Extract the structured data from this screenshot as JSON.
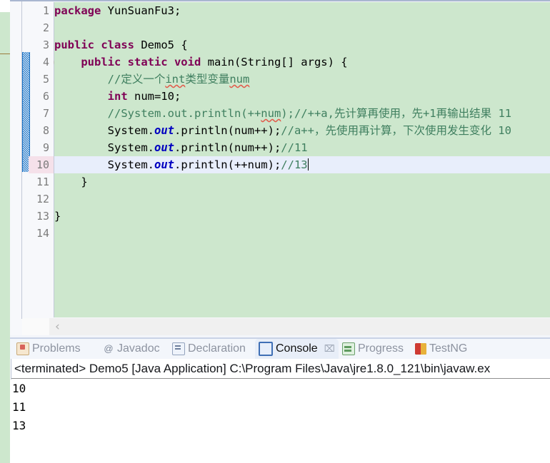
{
  "editor": {
    "gutter_lines": [
      "1",
      "2",
      "3",
      "4",
      "5",
      "6",
      "7",
      "8",
      "9",
      "10",
      "11",
      "12",
      "13",
      "14"
    ],
    "current_line": "10",
    "fold_marker_line": "4",
    "lines": [
      {
        "n": "1",
        "segments": [
          {
            "t": "package ",
            "c": "kw"
          },
          {
            "t": "YunSuanFu3;",
            "c": "plain"
          }
        ]
      },
      {
        "n": "2",
        "segments": []
      },
      {
        "n": "3",
        "segments": [
          {
            "t": "public class ",
            "c": "kw"
          },
          {
            "t": "Demo5 {",
            "c": "plain"
          }
        ]
      },
      {
        "n": "4",
        "segments": [
          {
            "t": "    ",
            "c": "plain"
          },
          {
            "t": "public static void ",
            "c": "kw"
          },
          {
            "t": "main(String[] args) {",
            "c": "plain"
          }
        ]
      },
      {
        "n": "5",
        "segments": [
          {
            "t": "        ",
            "c": "plain"
          },
          {
            "t": "//定义一个int类型变量num",
            "c": "cmt"
          }
        ]
      },
      {
        "n": "6",
        "segments": [
          {
            "t": "        ",
            "c": "plain"
          },
          {
            "t": "int ",
            "c": "kw"
          },
          {
            "t": "num=",
            "c": "plain"
          },
          {
            "t": "10",
            "c": "plain"
          },
          {
            "t": ";",
            "c": "plain"
          }
        ]
      },
      {
        "n": "7",
        "segments": [
          {
            "t": "        ",
            "c": "plain"
          },
          {
            "t": "//System.out.println(++num);//++a,先计算再使用，先+1再输出结果 11",
            "c": "cmt"
          }
        ]
      },
      {
        "n": "8",
        "segments": [
          {
            "t": "        ",
            "c": "plain"
          },
          {
            "t": "System.",
            "c": "plain"
          },
          {
            "t": "out",
            "c": "fld"
          },
          {
            "t": ".println(num++);",
            "c": "plain"
          },
          {
            "t": "//a++，先使用再计算，下次使用发生变化 10",
            "c": "cmt"
          }
        ]
      },
      {
        "n": "9",
        "segments": [
          {
            "t": "        ",
            "c": "plain"
          },
          {
            "t": "System.",
            "c": "plain"
          },
          {
            "t": "out",
            "c": "fld"
          },
          {
            "t": ".println(num++);",
            "c": "plain"
          },
          {
            "t": "//11",
            "c": "cmt"
          }
        ]
      },
      {
        "n": "10",
        "segments": [
          {
            "t": "        ",
            "c": "plain"
          },
          {
            "t": "System.",
            "c": "plain"
          },
          {
            "t": "out",
            "c": "fld"
          },
          {
            "t": ".println(++num);",
            "c": "plain"
          },
          {
            "t": "//13",
            "c": "cmt"
          }
        ]
      },
      {
        "n": "11",
        "segments": [
          {
            "t": "    }",
            "c": "plain"
          }
        ]
      },
      {
        "n": "12",
        "segments": []
      },
      {
        "n": "13",
        "segments": [
          {
            "t": "}",
            "c": "plain"
          }
        ]
      },
      {
        "n": "14",
        "segments": []
      }
    ],
    "line1_kw": "package ",
    "line1_rest": "YunSuanFu3;",
    "line3_kw": "public class ",
    "line3_rest": "Demo5 {",
    "line4_indent": "    ",
    "line4_kw": "public static void ",
    "line4_rest": "main(String[] args) {",
    "line5_indent": "        ",
    "line5_c1": "//定义一个",
    "line5_c2": "int",
    "line5_c3": "类型变量",
    "line5_c4": "num",
    "line6_indent": "        ",
    "line6_kw": "int ",
    "line6_rest": "num=10;",
    "line7_indent": "        ",
    "line7_c1": "//System.out.println(++",
    "line7_c2": "num",
    "line7_c3": ");//++a,先计算再使用，先+1再输出结果 11",
    "line8_indent": "        ",
    "line8_sys": "System.",
    "line8_fld": "out",
    "line8_call": ".println(num++);",
    "line8_cmt": "//a++，先使用再计算，下次使用发生变化 10",
    "line9_indent": "        ",
    "line9_sys": "System.",
    "line9_fld": "out",
    "line9_call": ".println(num++);",
    "line9_cmt": "//11",
    "line10_indent": "        ",
    "line10_sys": "System.",
    "line10_fld": "out",
    "line10_call": ".println(++num);",
    "line10_cmt": "//13",
    "line11": "    }",
    "line13": "}",
    "hscroll_left_arrow": "‹"
  },
  "bottom_panel": {
    "tabs": [
      {
        "label": "Problems",
        "icon": "problems-icon",
        "active": false,
        "closable": false
      },
      {
        "label": "Javadoc",
        "icon": "javadoc-icon",
        "active": false,
        "closable": false
      },
      {
        "label": "Declaration",
        "icon": "declaration-icon",
        "active": false,
        "closable": false
      },
      {
        "label": "Console",
        "icon": "console-icon",
        "active": true,
        "closable": true
      },
      {
        "label": "Progress",
        "icon": "progress-icon",
        "active": false,
        "closable": false
      },
      {
        "label": "TestNG",
        "icon": "testng-icon",
        "active": false,
        "closable": false
      }
    ],
    "tab_problems": "Problems",
    "tab_javadoc": "Javadoc",
    "tab_declaration": "Declaration",
    "tab_console": "Console",
    "tab_progress": "Progress",
    "tab_testng": "TestNG",
    "tab_close_glyph": "⌧",
    "javadoc_icon_glyph": "@",
    "status_text": "<terminated> Demo5 [Java Application] C:\\Program Files\\Java\\jre1.8.0_121\\bin\\javaw.ex",
    "output_lines": [
      "10",
      "11",
      "13"
    ]
  },
  "colors": {
    "editor_background": "#cde7cd",
    "keyword": "#7f0055",
    "comment": "#3f7f5f",
    "field": "#0000c0",
    "current_line_highlight": "#e8eefb",
    "current_line_gutter": "#f5e1ea",
    "fold_bar": "#1a72c4",
    "spellcheck_squiggle": "#e25b4b",
    "tab_active_background": "#e8eef8"
  }
}
